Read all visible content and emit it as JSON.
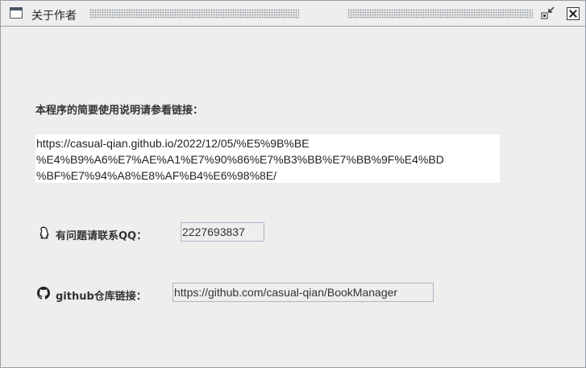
{
  "window": {
    "title": "关于作者"
  },
  "intro_label": "本程序的简要使用说明请参看链接：",
  "doc_link": {
    "lines": [
      "https://casual-qian.github.io/2022/12/05/%E5%9B%BE",
      "%E4%B9%A6%E7%AE%A1%E7%90%86%E7%B3%BB%E7%BB%9F%E4%BD",
      "%BF%E7%94%A8%E8%AF%B4%E6%98%8E/"
    ]
  },
  "qq": {
    "label": "有问题请联系QQ：",
    "value": "2227693837",
    "icon": "qq-penguin-icon"
  },
  "github": {
    "label": "github仓库链接：",
    "value": "https://github.com/casual-qian/BookManager",
    "icon": "github-icon"
  }
}
